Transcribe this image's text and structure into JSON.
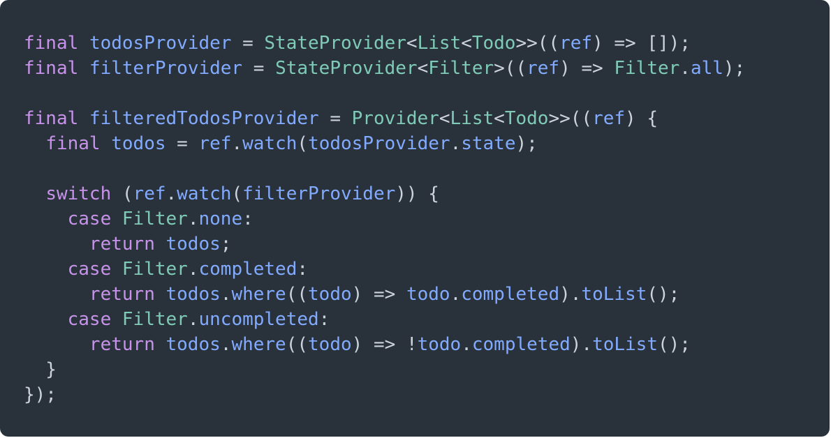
{
  "editor": {
    "language": "dart",
    "colors": {
      "background": "#29323a",
      "keyword": "#c792ea",
      "type": "#7fcbb8",
      "identifier": "#82aaff",
      "punctuation": "#cdd3de"
    },
    "lines": [
      {
        "tokens": [
          {
            "t": "final",
            "k": "keyword"
          },
          {
            "t": " ",
            "k": "punct"
          },
          {
            "t": "todosProvider",
            "k": "ident"
          },
          {
            "t": " = ",
            "k": "punct"
          },
          {
            "t": "StateProvider",
            "k": "type"
          },
          {
            "t": "<",
            "k": "punct"
          },
          {
            "t": "List",
            "k": "type"
          },
          {
            "t": "<",
            "k": "punct"
          },
          {
            "t": "Todo",
            "k": "type"
          },
          {
            "t": ">>((",
            "k": "punct"
          },
          {
            "t": "ref",
            "k": "ident"
          },
          {
            "t": ") => []);",
            "k": "punct"
          }
        ]
      },
      {
        "tokens": [
          {
            "t": "final",
            "k": "keyword"
          },
          {
            "t": " ",
            "k": "punct"
          },
          {
            "t": "filterProvider",
            "k": "ident"
          },
          {
            "t": " = ",
            "k": "punct"
          },
          {
            "t": "StateProvider",
            "k": "type"
          },
          {
            "t": "<",
            "k": "punct"
          },
          {
            "t": "Filter",
            "k": "type"
          },
          {
            "t": ">((",
            "k": "punct"
          },
          {
            "t": "ref",
            "k": "ident"
          },
          {
            "t": ") => ",
            "k": "punct"
          },
          {
            "t": "Filter",
            "k": "type"
          },
          {
            "t": ".",
            "k": "punct"
          },
          {
            "t": "all",
            "k": "ident"
          },
          {
            "t": ");",
            "k": "punct"
          }
        ]
      },
      {
        "tokens": []
      },
      {
        "tokens": [
          {
            "t": "final",
            "k": "keyword"
          },
          {
            "t": " ",
            "k": "punct"
          },
          {
            "t": "filteredTodosProvider",
            "k": "ident"
          },
          {
            "t": " = ",
            "k": "punct"
          },
          {
            "t": "Provider",
            "k": "type"
          },
          {
            "t": "<",
            "k": "punct"
          },
          {
            "t": "List",
            "k": "type"
          },
          {
            "t": "<",
            "k": "punct"
          },
          {
            "t": "Todo",
            "k": "type"
          },
          {
            "t": ">>((",
            "k": "punct"
          },
          {
            "t": "ref",
            "k": "ident"
          },
          {
            "t": ") {",
            "k": "punct"
          }
        ]
      },
      {
        "tokens": [
          {
            "t": "  ",
            "k": "punct"
          },
          {
            "t": "final",
            "k": "keyword"
          },
          {
            "t": " ",
            "k": "punct"
          },
          {
            "t": "todos",
            "k": "ident"
          },
          {
            "t": " = ",
            "k": "punct"
          },
          {
            "t": "ref",
            "k": "ident"
          },
          {
            "t": ".",
            "k": "punct"
          },
          {
            "t": "watch",
            "k": "ident"
          },
          {
            "t": "(",
            "k": "punct"
          },
          {
            "t": "todosProvider",
            "k": "ident"
          },
          {
            "t": ".",
            "k": "punct"
          },
          {
            "t": "state",
            "k": "ident"
          },
          {
            "t": ");",
            "k": "punct"
          }
        ]
      },
      {
        "tokens": []
      },
      {
        "tokens": [
          {
            "t": "  ",
            "k": "punct"
          },
          {
            "t": "switch",
            "k": "keyword"
          },
          {
            "t": " (",
            "k": "punct"
          },
          {
            "t": "ref",
            "k": "ident"
          },
          {
            "t": ".",
            "k": "punct"
          },
          {
            "t": "watch",
            "k": "ident"
          },
          {
            "t": "(",
            "k": "punct"
          },
          {
            "t": "filterProvider",
            "k": "ident"
          },
          {
            "t": ")) {",
            "k": "punct"
          }
        ]
      },
      {
        "tokens": [
          {
            "t": "    ",
            "k": "punct"
          },
          {
            "t": "case",
            "k": "keyword"
          },
          {
            "t": " ",
            "k": "punct"
          },
          {
            "t": "Filter",
            "k": "type"
          },
          {
            "t": ".",
            "k": "punct"
          },
          {
            "t": "none",
            "k": "ident"
          },
          {
            "t": ":",
            "k": "punct"
          }
        ]
      },
      {
        "tokens": [
          {
            "t": "      ",
            "k": "punct"
          },
          {
            "t": "return",
            "k": "keyword"
          },
          {
            "t": " ",
            "k": "punct"
          },
          {
            "t": "todos",
            "k": "ident"
          },
          {
            "t": ";",
            "k": "punct"
          }
        ]
      },
      {
        "tokens": [
          {
            "t": "    ",
            "k": "punct"
          },
          {
            "t": "case",
            "k": "keyword"
          },
          {
            "t": " ",
            "k": "punct"
          },
          {
            "t": "Filter",
            "k": "type"
          },
          {
            "t": ".",
            "k": "punct"
          },
          {
            "t": "completed",
            "k": "ident"
          },
          {
            "t": ":",
            "k": "punct"
          }
        ]
      },
      {
        "tokens": [
          {
            "t": "      ",
            "k": "punct"
          },
          {
            "t": "return",
            "k": "keyword"
          },
          {
            "t": " ",
            "k": "punct"
          },
          {
            "t": "todos",
            "k": "ident"
          },
          {
            "t": ".",
            "k": "punct"
          },
          {
            "t": "where",
            "k": "ident"
          },
          {
            "t": "((",
            "k": "punct"
          },
          {
            "t": "todo",
            "k": "ident"
          },
          {
            "t": ") => ",
            "k": "punct"
          },
          {
            "t": "todo",
            "k": "ident"
          },
          {
            "t": ".",
            "k": "punct"
          },
          {
            "t": "completed",
            "k": "ident"
          },
          {
            "t": ").",
            "k": "punct"
          },
          {
            "t": "toList",
            "k": "ident"
          },
          {
            "t": "();",
            "k": "punct"
          }
        ]
      },
      {
        "tokens": [
          {
            "t": "    ",
            "k": "punct"
          },
          {
            "t": "case",
            "k": "keyword"
          },
          {
            "t": " ",
            "k": "punct"
          },
          {
            "t": "Filter",
            "k": "type"
          },
          {
            "t": ".",
            "k": "punct"
          },
          {
            "t": "uncompleted",
            "k": "ident"
          },
          {
            "t": ":",
            "k": "punct"
          }
        ]
      },
      {
        "tokens": [
          {
            "t": "      ",
            "k": "punct"
          },
          {
            "t": "return",
            "k": "keyword"
          },
          {
            "t": " ",
            "k": "punct"
          },
          {
            "t": "todos",
            "k": "ident"
          },
          {
            "t": ".",
            "k": "punct"
          },
          {
            "t": "where",
            "k": "ident"
          },
          {
            "t": "((",
            "k": "punct"
          },
          {
            "t": "todo",
            "k": "ident"
          },
          {
            "t": ") => !",
            "k": "punct"
          },
          {
            "t": "todo",
            "k": "ident"
          },
          {
            "t": ".",
            "k": "punct"
          },
          {
            "t": "completed",
            "k": "ident"
          },
          {
            "t": ").",
            "k": "punct"
          },
          {
            "t": "toList",
            "k": "ident"
          },
          {
            "t": "();",
            "k": "punct"
          }
        ]
      },
      {
        "tokens": [
          {
            "t": "  }",
            "k": "punct"
          }
        ]
      },
      {
        "tokens": [
          {
            "t": "});",
            "k": "punct"
          }
        ]
      }
    ]
  }
}
